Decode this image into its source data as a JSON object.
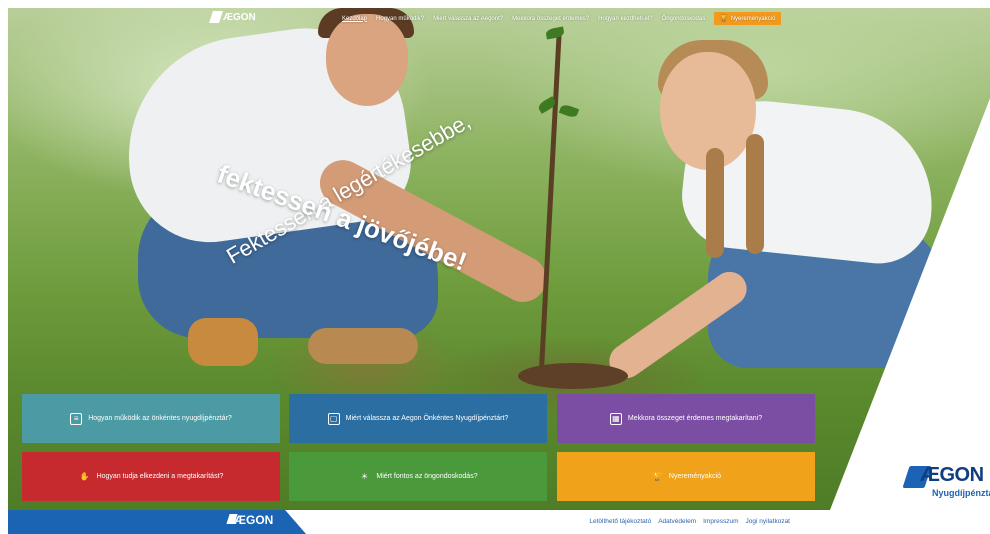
{
  "brand": {
    "logo_text": "ÆGON",
    "logo_subtext": "Nyugdíjpénztár"
  },
  "nav": {
    "items": [
      {
        "label": "Kezdőlap",
        "active": true
      },
      {
        "label": "Hogyan működik?",
        "active": false
      },
      {
        "label": "Miért válassza az Aegont?",
        "active": false
      },
      {
        "label": "Mekkora összeget érdemes?",
        "active": false
      },
      {
        "label": "Hogyan kezdheti el?",
        "active": false
      },
      {
        "label": "Öngondoskodás",
        "active": false
      }
    ],
    "cta_label": "Nyereményakció",
    "cta_icon": "trophy-icon",
    "cta_color": "#f39a1e"
  },
  "hero": {
    "headline_line1": "Fektessen a legértékesebbe,",
    "headline_line2": "fektessen a jövőjébe!"
  },
  "tiles": [
    {
      "label": "Hogyan működik az önkéntes nyugdíjpénztár?",
      "icon": "document-icon",
      "color": "#4c9aa3"
    },
    {
      "label": "Miért válassza az Aegon Önkéntes Nyugdíjpénztárt?",
      "icon": "cards-icon",
      "color": "#2b6fa2"
    },
    {
      "label": "Mekkora összeget érdemes megtakarítani?",
      "icon": "calculator-icon",
      "color": "#7b4ea3"
    },
    {
      "label": "Hogyan tudja elkezdeni a megtakarítást?",
      "icon": "hand-icon",
      "color": "#c62a2e"
    },
    {
      "label": "Miért fontos az öngondoskodás?",
      "icon": "lightbulb-icon",
      "color": "#4a9a3c"
    },
    {
      "label": "Nyereményakció",
      "icon": "trophy-icon",
      "color": "#f0a21b"
    }
  ],
  "footer": {
    "links": [
      "Letölthető tájékoztató",
      "Adatvédelem",
      "Impresszum",
      "Jogi nyilatkozat"
    ]
  }
}
